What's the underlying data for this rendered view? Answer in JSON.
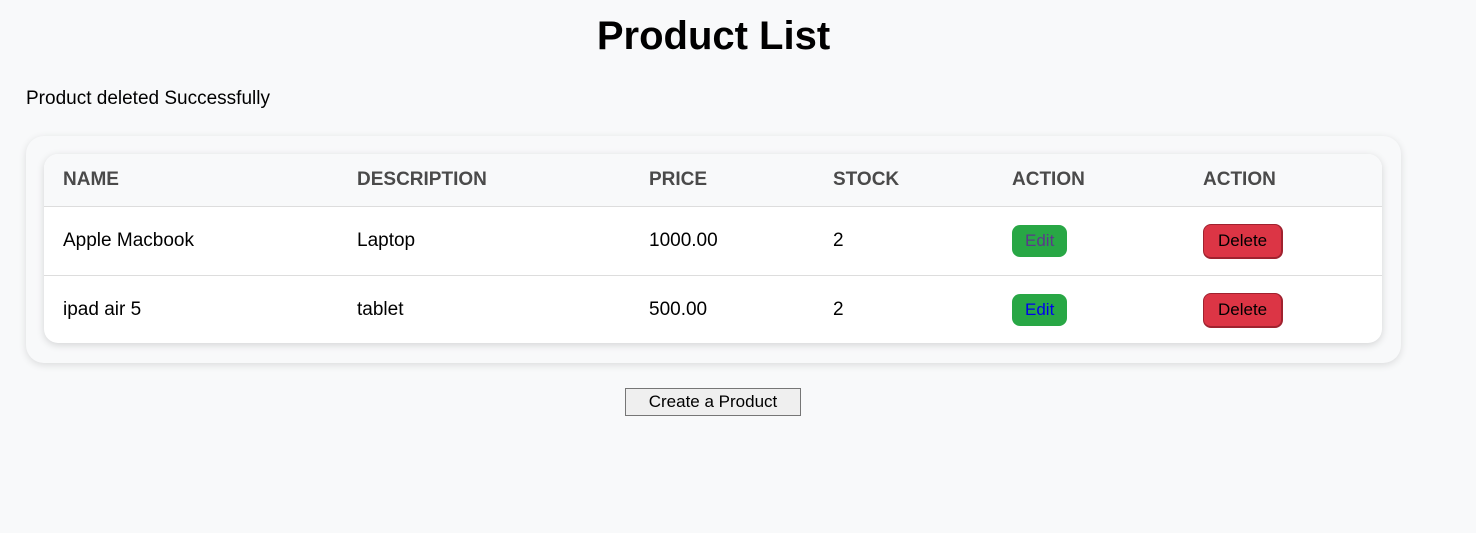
{
  "title": "Product List",
  "message": "Product deleted Successfully",
  "table": {
    "headers": [
      "NAME",
      "DESCRIPTION",
      "PRICE",
      "STOCK",
      "ACTION",
      "ACTION"
    ],
    "rows": [
      {
        "name": "Apple Macbook",
        "description": "Laptop",
        "price": "1000.00",
        "stock": "2",
        "edit": "Edit",
        "delete": "Delete"
      },
      {
        "name": "ipad air 5",
        "description": "tablet",
        "price": "500.00",
        "stock": "2",
        "edit": "Edit",
        "delete": "Delete"
      }
    ]
  },
  "create_label": "Create a Product"
}
